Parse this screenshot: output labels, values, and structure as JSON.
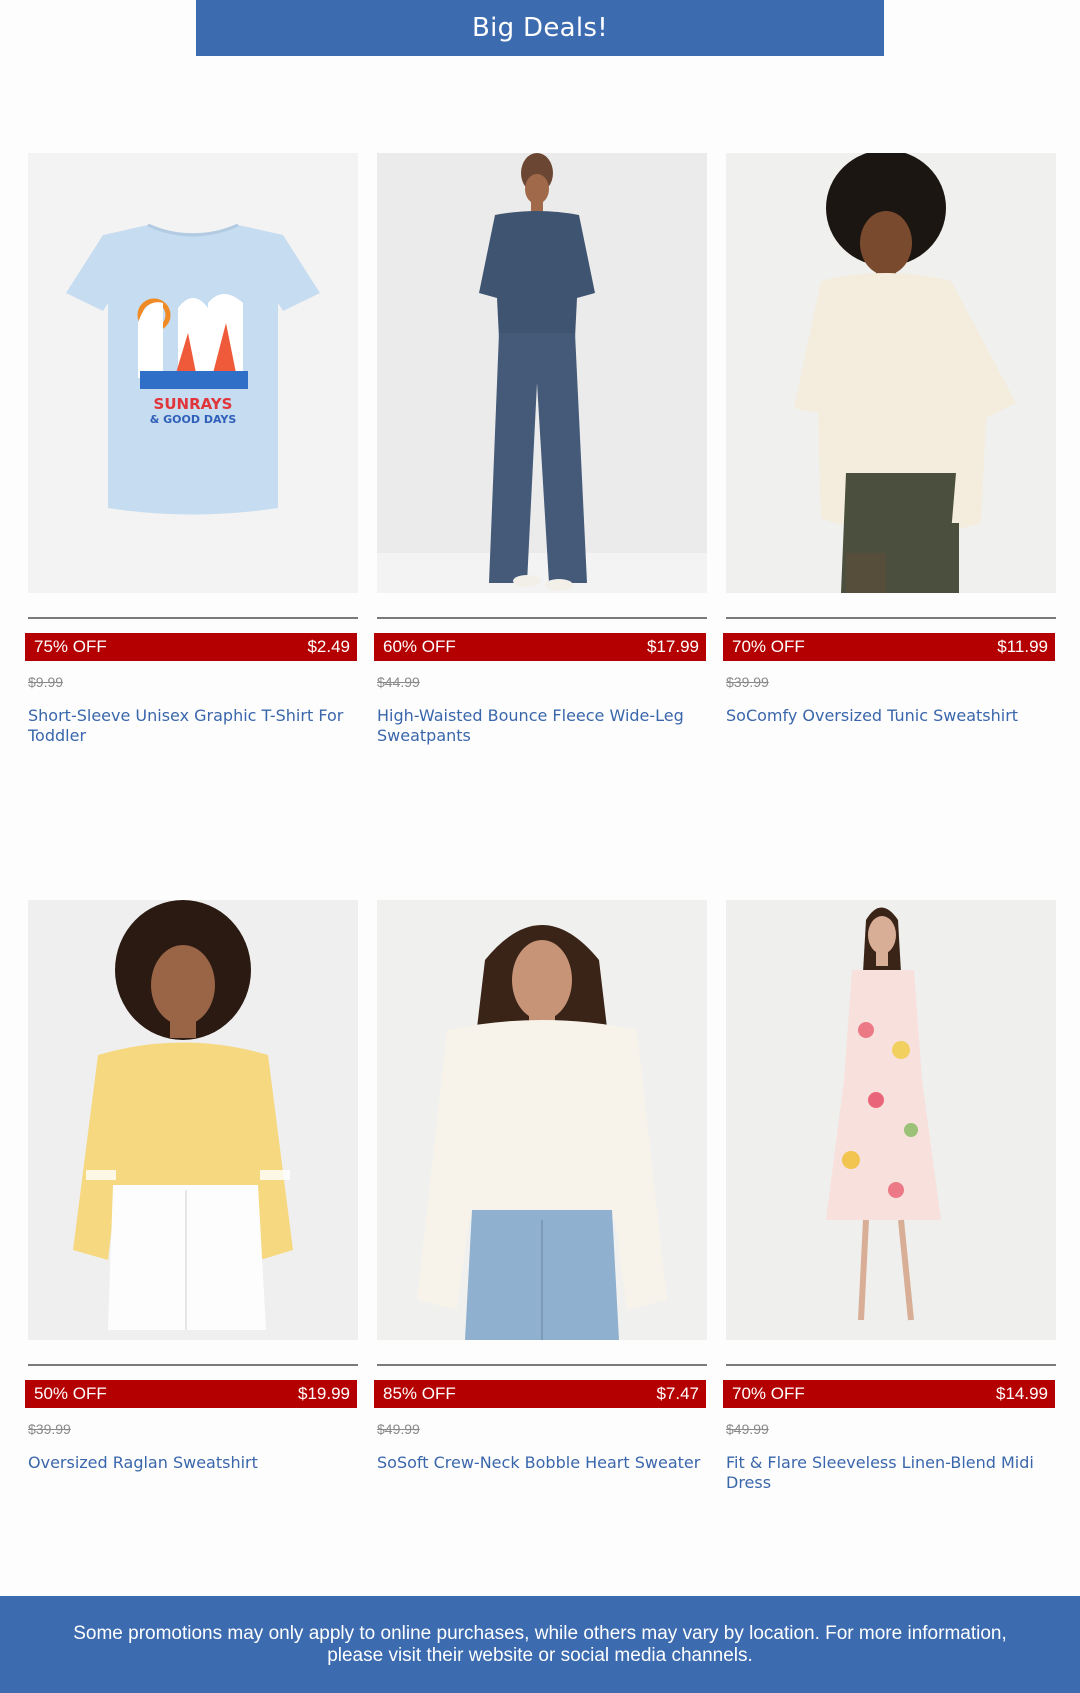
{
  "header": {
    "title": "Big Deals!"
  },
  "products": [
    {
      "discount": "75% OFF",
      "price": "$2.49",
      "original_price": "$9.99",
      "name": "Short-Sleeve Unisex Graphic T-Shirt For Toddler",
      "image": "toddler-tshirt-image",
      "shirt_text_1": "SUNRAYS",
      "shirt_text_2": "& GOOD DAYS"
    },
    {
      "discount": "60% OFF",
      "price": "$17.99",
      "original_price": "$44.99",
      "name": "High-Waisted Bounce Fleece Wide-Leg Sweatpants",
      "image": "model-navy-sweatpants-image"
    },
    {
      "discount": "70% OFF",
      "price": "$11.99",
      "original_price": "$39.99",
      "name": "SoComfy Oversized Tunic Sweatshirt",
      "image": "model-cream-sweatshirt-image"
    },
    {
      "discount": "50% OFF",
      "price": "$19.99",
      "original_price": "$39.99",
      "name": "Oversized Raglan Sweatshirt",
      "image": "model-yellow-sweatshirt-image"
    },
    {
      "discount": "85% OFF",
      "price": "$7.47",
      "original_price": "$49.99",
      "name": "SoSoft Crew-Neck Bobble Heart Sweater",
      "image": "model-white-sweater-image"
    },
    {
      "discount": "70% OFF",
      "price": "$14.99",
      "original_price": "$49.99",
      "name": "Fit & Flare Sleeveless Linen-Blend Midi Dress",
      "image": "model-floral-dress-image"
    }
  ],
  "footer": {
    "disclaimer": "Some promotions may only apply to online purchases, while others may vary by location. For more information, please visit their website or social media channels."
  },
  "colors": {
    "brand_blue": "#3c6bb0",
    "sale_red": "#b40000",
    "link_blue": "#3a66ab",
    "strike_gray": "#8a8a8a"
  }
}
